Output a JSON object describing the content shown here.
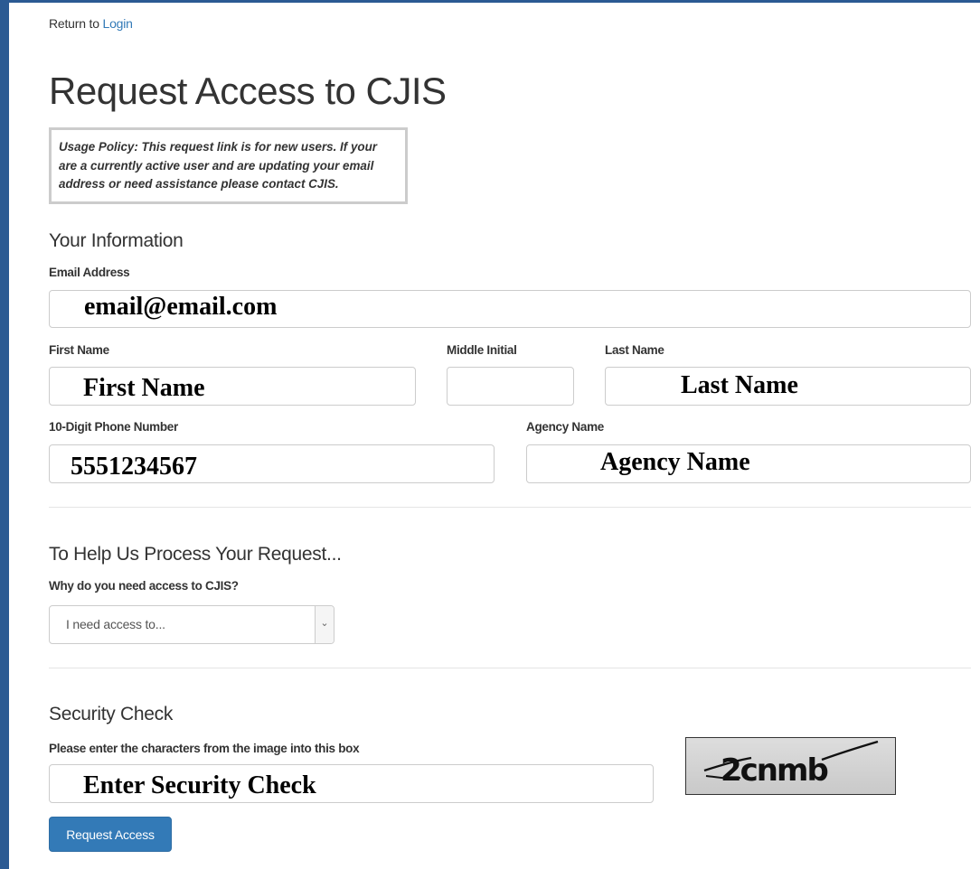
{
  "header": {
    "return_prefix": "Return to",
    "login_link": "Login",
    "title": "Request Access to CJIS"
  },
  "policy": {
    "text": "Usage Policy: This request link is for new users. If your are a currently active user and are updating your email address or need assistance please contact CJIS."
  },
  "your_info": {
    "heading": "Your Information",
    "email": {
      "label": "Email Address",
      "value": "email@email.com"
    },
    "first_name": {
      "label": "First Name",
      "value": "First Name"
    },
    "middle_initial": {
      "label": "Middle Initial",
      "value": ""
    },
    "last_name": {
      "label": "Last Name",
      "value": "Last Name"
    },
    "phone": {
      "label": "10-Digit Phone Number",
      "value": "5551234567"
    },
    "agency": {
      "label": "Agency Name",
      "value": "Agency Name"
    }
  },
  "process": {
    "heading": "To Help Us Process Your Request...",
    "reason_label": "Why do you need access to CJIS?",
    "reason_selected": "I need access to..."
  },
  "security": {
    "heading": "Security Check",
    "instructions": "Please enter the characters from the image into this box",
    "input_value": "Enter Security Check",
    "captcha_text": "2cnmb"
  },
  "submit": {
    "label": "Request Access"
  },
  "colors": {
    "accent": "#337ab7",
    "frame": "#2b5a93"
  }
}
